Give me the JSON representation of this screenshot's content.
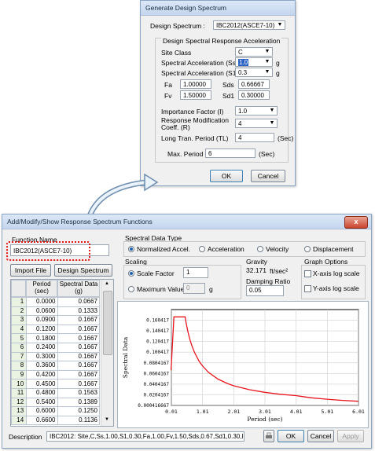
{
  "gds": {
    "title": "Generate Design Spectrum",
    "design_spectrum_label": "Design Spectrum :",
    "design_spectrum_value": "IBC2012(ASCE7-10)",
    "group_title": "Design Spectral Response Acceleration",
    "site_class_label": "Site Class",
    "site_class_value": "C",
    "ss_label": "Spectral Acceleration (Ss)",
    "ss_value": "1.0",
    "s1_label": "Spectral Acceleration (S1)",
    "s1_value": "0.3",
    "unit_g": "g",
    "fa_label": "Fa",
    "fa_value": "1.00000",
    "sds_label": "Sds",
    "sds_value": "0.66667",
    "fv_label": "Fv",
    "fv_value": "1.50000",
    "sd1_label": "Sd1",
    "sd1_value": "0.30000",
    "importance_label": "Importance Factor (I)",
    "importance_value": "1.0",
    "response_label_1": "Response Modification",
    "response_label_2": "Coeff. (R)",
    "response_value": "4",
    "longtran_label": "Long Tran. Period (TL)",
    "longtran_value": "4",
    "unit_sec": "(Sec)",
    "maxperiod_label": "Max. Period :",
    "maxperiod_value": "6",
    "ok": "OK",
    "cancel": "Cancel"
  },
  "main": {
    "title": "Add/Modify/Show Response Spectrum Functions",
    "function_name_label": "Function Name",
    "function_name_value": "IBC2012(ASCE7-10)",
    "import_file": "Import File",
    "design_spectrum_btn": "Design Spectrum",
    "col_period_1": "Period",
    "col_period_2": "(sec)",
    "col_spectral_1": "Spectral Data",
    "col_spectral_2": "(g)",
    "rows": [
      {
        "n": "1",
        "period": "0.0000",
        "value": "0.0667"
      },
      {
        "n": "2",
        "period": "0.0600",
        "value": "0.1333"
      },
      {
        "n": "3",
        "period": "0.0900",
        "value": "0.1667"
      },
      {
        "n": "4",
        "period": "0.1200",
        "value": "0.1667"
      },
      {
        "n": "5",
        "period": "0.1800",
        "value": "0.1667"
      },
      {
        "n": "6",
        "period": "0.2400",
        "value": "0.1667"
      },
      {
        "n": "7",
        "period": "0.3000",
        "value": "0.1667"
      },
      {
        "n": "8",
        "period": "0.3600",
        "value": "0.1667"
      },
      {
        "n": "9",
        "period": "0.4200",
        "value": "0.1667"
      },
      {
        "n": "10",
        "period": "0.4500",
        "value": "0.1667"
      },
      {
        "n": "11",
        "period": "0.4800",
        "value": "0.1563"
      },
      {
        "n": "12",
        "period": "0.5400",
        "value": "0.1389"
      },
      {
        "n": "13",
        "period": "0.6000",
        "value": "0.1250"
      },
      {
        "n": "14",
        "period": "0.6600",
        "value": "0.1136"
      }
    ],
    "spectral_type_label": "Spectral Data Type",
    "type_normalized": "Normalized Accel.",
    "type_acceleration": "Acceleration",
    "type_velocity": "Velocity",
    "type_displacement": "Displacement",
    "scaling_label": "Scaling",
    "scale_factor_label": "Scale Factor",
    "scale_factor_value": "1",
    "max_value_label": "Maximum Value",
    "max_value_value": "0",
    "unit_g": "g",
    "gravity_label": "Gravity",
    "gravity_value": "32.171",
    "gravity_unit": "ft/sec²",
    "damping_label": "Damping Ratio",
    "damping_value": "0.05",
    "graph_options_label": "Graph Options",
    "xlog_label": "X-axis log scale",
    "ylog_label": "Y-axis log scale",
    "description_label": "Description",
    "description_value": "IBC2012: Site,C,Ss,1.00,S1,0.30,Fa,1.00,Fv,1.50,Sds,0.67,Sd1,0.30,I,",
    "ok": "OK",
    "cancel": "Cancel",
    "apply": "Apply"
  },
  "chart_data": {
    "type": "line",
    "title": "",
    "xlabel": "Period (sec)",
    "ylabel": "Spectral Data",
    "x_ticks": [
      "0.01",
      "1.01",
      "2.01",
      "3.01",
      "4.01",
      "5.01",
      "6.01"
    ],
    "y_ticks": [
      "0.000416667",
      "0.0204167",
      "0.0404167",
      "0.0604167",
      "0.0804167",
      "0.100417",
      "0.120417",
      "0.140417",
      "0.160417"
    ],
    "xlim": [
      0.01,
      6.01
    ],
    "ylim": [
      0.000416667,
      0.180417
    ],
    "grid": true,
    "series": [
      {
        "color": "#e8141e",
        "x": [
          0.0,
          0.06,
          0.09,
          0.12,
          0.18,
          0.24,
          0.3,
          0.36,
          0.42,
          0.45,
          0.48,
          0.54,
          0.6,
          0.66,
          0.75,
          0.9,
          1.0,
          1.2,
          1.5,
          1.8,
          2.0,
          2.5,
          3.0,
          3.5,
          4.0,
          4.5,
          5.0,
          5.5,
          6.0
        ],
        "y": [
          0.0667,
          0.1333,
          0.1667,
          0.1667,
          0.1667,
          0.1667,
          0.1667,
          0.1667,
          0.1667,
          0.1667,
          0.1563,
          0.1389,
          0.125,
          0.1136,
          0.1,
          0.0833,
          0.075,
          0.0625,
          0.05,
          0.0417,
          0.0375,
          0.03,
          0.025,
          0.0214,
          0.0188,
          0.0148,
          0.012,
          0.0099,
          0.0083
        ]
      }
    ]
  }
}
